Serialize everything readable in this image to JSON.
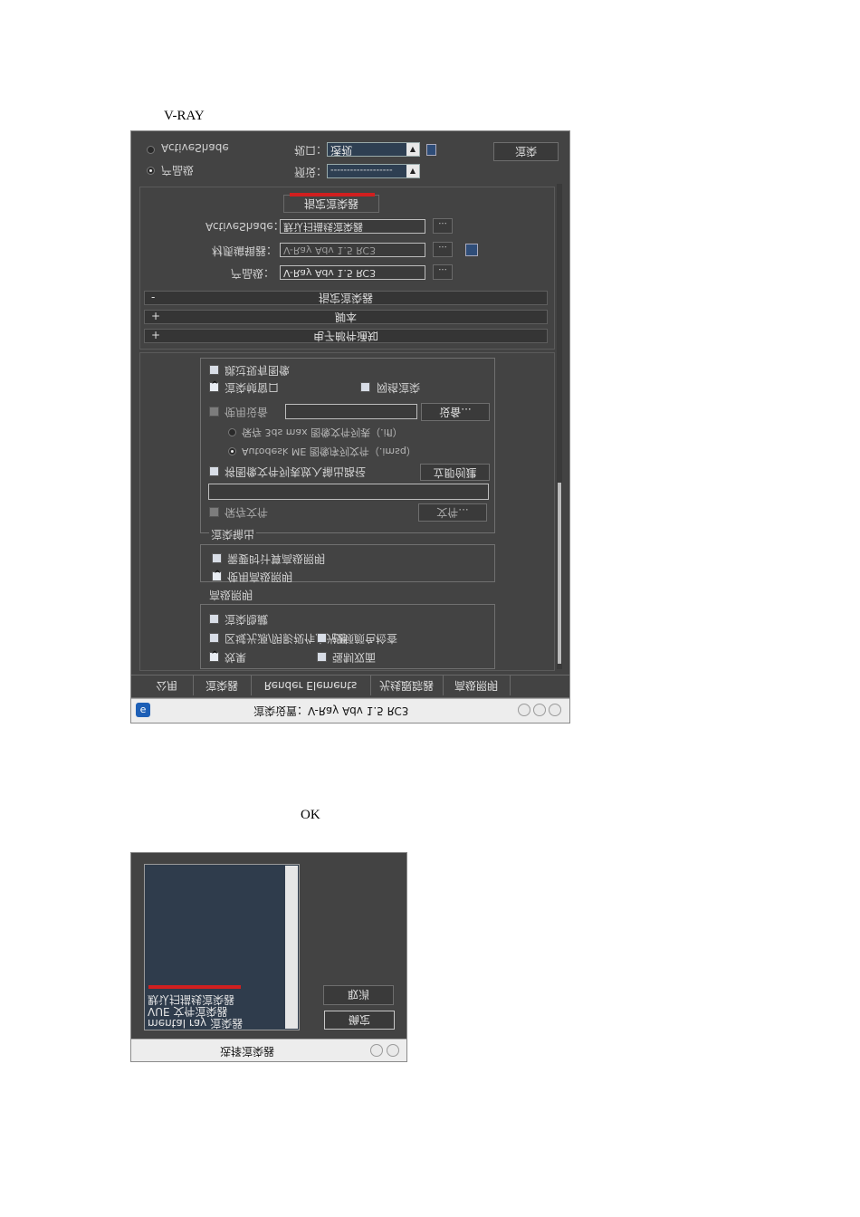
{
  "doc": {
    "heading": "V-RAY",
    "ok_caption": "OK"
  },
  "render_dialog": {
    "radio_activeshade": "ActiveShade",
    "radio_production": "产品级",
    "viewport_label": "视口：",
    "viewport_value": "透视",
    "preset_label": "预设：",
    "preset_value": "-------------------",
    "render_button": "渲染",
    "assign_renderer_title": "指定渲染器",
    "activeshade_label": "ActiveShade：",
    "activeshade_value": "默认扫描线渲染器",
    "material_editor_label": "材质编辑器：",
    "material_editor_value": "V-Ray Adv 1.5 RC3",
    "production_label": "产品级：",
    "production_value": "V-Ray Adv 1.5 RC3",
    "dots_label": "...",
    "rollouts": [
      {
        "sign": "-",
        "title": "指定渲染器"
      },
      {
        "sign": "+",
        "title": "脚本"
      },
      {
        "sign": "+",
        "title": "电子邮件通知"
      }
    ],
    "opt_render_frame_window": "渲染帧窗口",
    "opt_save_file_top": "跳过现有图像",
    "opt_net_render": "网络渲染",
    "opt_use_device": "使用设备",
    "devices_button": "设备...",
    "radio_3dsmax": "保存 3ds max 图像文件列表（.ifl）",
    "radio_autodesk": "Autodesk ME 图像序列文件（.imsq）",
    "opt_put_image_list": "将图像文件列表放入输出路径",
    "create_now_button": "立即创建",
    "opt_save_file": "保存文件",
    "files_button": "文件...",
    "render_output_group": "渲染输出",
    "opt_compute_adv_lighting": "需要时计算高级照明",
    "opt_use_adv_lighting": "使用高级照明",
    "adv_lighting_group": "高级照明",
    "opt_render_hidden": "渲染隐藏",
    "opt_displacement": "置换",
    "opt_video_check": "视频颜色检查",
    "opt_force_two_sided": "强制双面",
    "opt_effects": "效果",
    "opt_area_lights": "区域光源/阴影视作点光源",
    "tabs": [
      "公用",
      "渲染器",
      "Render Elements",
      "光线跟踪器",
      "高级照明"
    ],
    "title_bar": "渲染设置：V-Ray Adv 1.5 RC3"
  },
  "choose_dialog": {
    "list_items": [
      "默认扫描线渲染器",
      "VUE 文件渲染器",
      "mental ray 渲染器"
    ],
    "ok_button": "确定",
    "cancel_button": "取消",
    "title_bar": "选择渲染器"
  },
  "colors": {
    "panel_bg": "#434343",
    "list_bg": "#2f3c4c",
    "highlight_red": "#d11f1f"
  }
}
